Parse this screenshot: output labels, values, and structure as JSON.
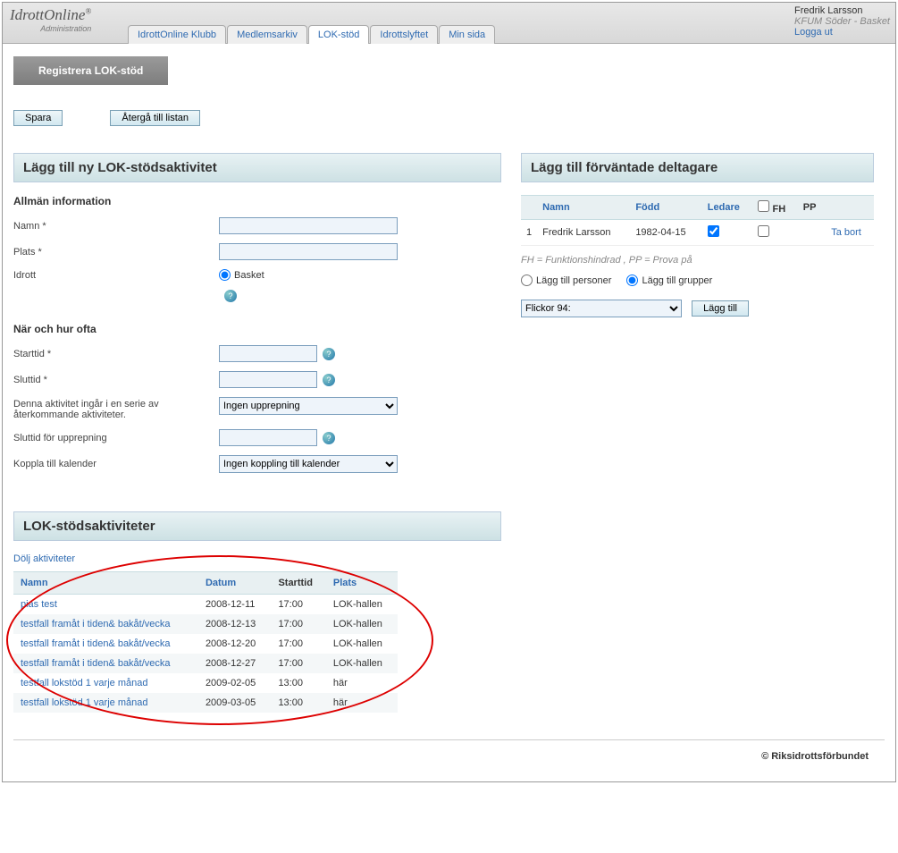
{
  "header": {
    "logo_main": "IdrottOnline",
    "logo_sub": "Administration",
    "tabs": [
      "IdrottOnline Klubb",
      "Medlemsarkiv",
      "LOK-stöd",
      "Idrottslyftet",
      "Min sida"
    ],
    "active_tab": 2,
    "user_name": "Fredrik Larsson",
    "user_org": "KFUM Söder - Basket",
    "logout": "Logga ut"
  },
  "page": {
    "title": "Registrera LOK-stöd",
    "buttons": {
      "save": "Spara",
      "back": "Återgå till listan"
    }
  },
  "left": {
    "panel_title": "Lägg till ny LOK-stödsaktivitet",
    "section_general": "Allmän information",
    "labels": {
      "namn": "Namn *",
      "plats": "Plats *",
      "idrott": "Idrott",
      "idrott_option": "Basket"
    },
    "section_when": "När och hur ofta",
    "labels2": {
      "starttid": "Starttid *",
      "sluttid": "Sluttid *",
      "serie": "Denna aktivitet ingår i en serie av återkommande aktiviteter.",
      "serie_option": "Ingen upprepning",
      "slut_upprepning": "Sluttid för upprepning",
      "kalender": "Koppla till kalender",
      "kalender_option": "Ingen koppling till kalender"
    }
  },
  "right": {
    "panel_title": "Lägg till förväntade deltagare",
    "columns": {
      "namn": "Namn",
      "fodd": "Född",
      "ledare": "Ledare",
      "fh": "FH",
      "pp": "PP"
    },
    "rows": [
      {
        "idx": "1",
        "namn": "Fredrik Larsson",
        "fodd": "1982-04-15",
        "ledare": true,
        "fh": false,
        "remove": "Ta bort"
      }
    ],
    "legend": "FH = Funktionshindrad , PP = Prova på",
    "add_persons": "Lägg till personer",
    "add_groups": "Lägg till grupper",
    "group_selected": "Flickor 94:",
    "add_btn": "Lägg till"
  },
  "activities": {
    "panel_title": "LOK-stödsaktiviteter",
    "toggle": "Dölj aktiviteter",
    "columns": {
      "namn": "Namn",
      "datum": "Datum",
      "starttid": "Starttid",
      "plats": "Plats"
    },
    "rows": [
      {
        "namn": "pias test",
        "datum": "2008-12-11",
        "starttid": "17:00",
        "plats": "LOK-hallen"
      },
      {
        "namn": "testfall framåt i tiden& bakåt/vecka",
        "datum": "2008-12-13",
        "starttid": "17:00",
        "plats": "LOK-hallen"
      },
      {
        "namn": "testfall framåt i tiden& bakåt/vecka",
        "datum": "2008-12-20",
        "starttid": "17:00",
        "plats": "LOK-hallen"
      },
      {
        "namn": "testfall framåt i tiden& bakåt/vecka",
        "datum": "2008-12-27",
        "starttid": "17:00",
        "plats": "LOK-hallen"
      },
      {
        "namn": "testfall lokstöd 1 varje månad",
        "datum": "2009-02-05",
        "starttid": "13:00",
        "plats": "här"
      },
      {
        "namn": "testfall lokstöd 1 varje månad",
        "datum": "2009-03-05",
        "starttid": "13:00",
        "plats": "här"
      }
    ]
  },
  "footer": "© Riksidrottsförbundet"
}
